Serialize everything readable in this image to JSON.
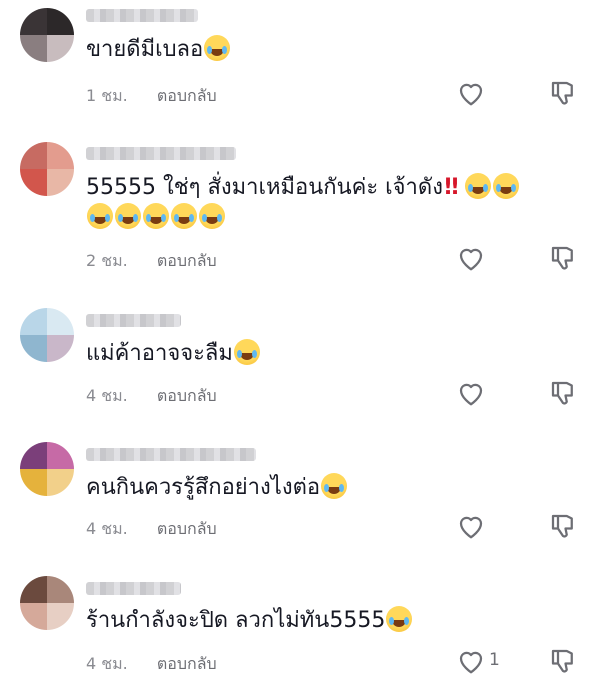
{
  "comments": [
    {
      "text": "ขายดีมีเบลอ",
      "emojis": [
        "face-with-tears-of-joy-icon"
      ],
      "time": "1 ชม.",
      "reply_label": "ตอบกลับ",
      "likes": ""
    },
    {
      "text": "55555 ใช่ๆ สั่งมาเหมือนกันค่ะ เจ้าดัง",
      "text_line2_emoji_count": 5,
      "emojis": [
        "double-exclamation-icon",
        "face-with-tears-of-joy-icon",
        "face-with-tears-of-joy-icon"
      ],
      "time": "2 ชม.",
      "reply_label": "ตอบกลับ",
      "likes": ""
    },
    {
      "text": "แม่ค้าอาจจะลืม",
      "emojis": [
        "face-with-tears-of-joy-icon"
      ],
      "time": "4 ชม.",
      "reply_label": "ตอบกลับ",
      "likes": ""
    },
    {
      "text": "คนกินควรรู้สึกอย่างไงต่อ",
      "emojis": [
        "face-with-tears-of-joy-icon"
      ],
      "time": "4 ชม.",
      "reply_label": "ตอบกลับ",
      "likes": ""
    },
    {
      "text": "ร้านกำลังจะปิด ลวกไม่ทัน5555",
      "emojis": [
        "face-with-tears-of-joy-icon"
      ],
      "time": "4 ชม.",
      "reply_label": "ตอบกลับ",
      "likes": "1"
    }
  ],
  "icons": {
    "like": "heart-outline-icon",
    "dislike": "thumbs-down-outline-icon",
    "emoji": "face-with-tears-of-joy-icon"
  },
  "colors": {
    "text": "#161823",
    "meta": "#8a8b91",
    "icon": "#6d6e74",
    "emoji_bang": "#d6172a"
  }
}
